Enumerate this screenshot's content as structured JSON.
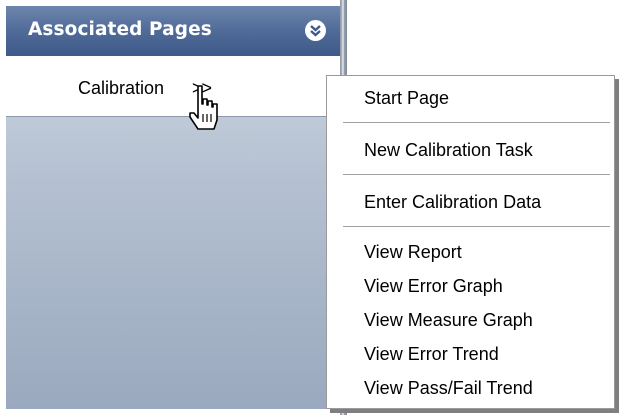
{
  "sidebar": {
    "title": "Associated Pages",
    "collapse_icon": "double-chevron-down-icon",
    "link": {
      "label": "Calibration",
      "arrow": ">>"
    }
  },
  "context_menu": {
    "items": [
      {
        "label": "Start Page"
      },
      {
        "label": "New Calibration Task"
      },
      {
        "label": "Enter Calibration Data"
      },
      {
        "label": "View Report"
      },
      {
        "label": "View Error Graph"
      },
      {
        "label": "View Measure Graph"
      },
      {
        "label": "View Error Trend"
      },
      {
        "label": "View Pass/Fail Trend"
      }
    ]
  },
  "colors": {
    "header": "#506b98",
    "panel": "#b6c2d2",
    "menu_bg": "#ffffff"
  },
  "cursor_icon": "hand-pointer-icon"
}
